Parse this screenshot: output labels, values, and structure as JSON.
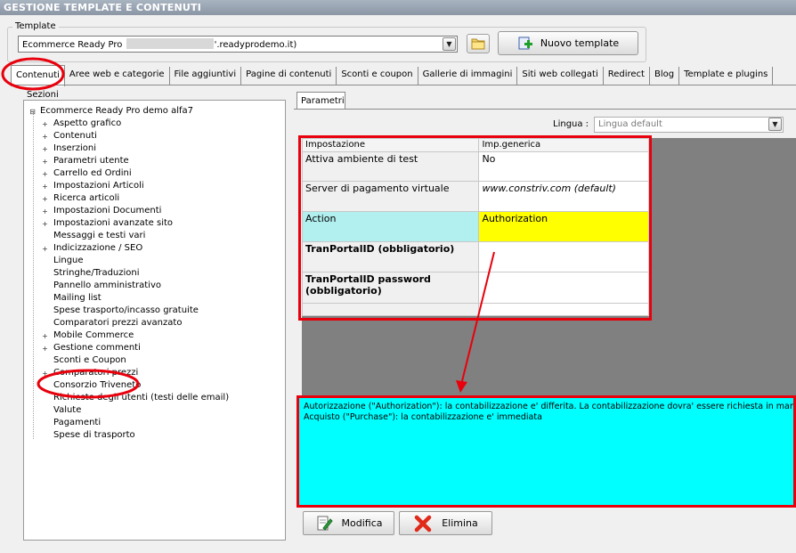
{
  "window": {
    "title": "GESTIONE TEMPLATE E CONTENUTI"
  },
  "template": {
    "group_label": "Template",
    "selected_prefix": "Ecommerce Ready Pro",
    "selected_suffix": "'.readyprodemo.it)",
    "new_button": "Nuovo template"
  },
  "tabs": [
    "Contenuti",
    "Aree web e categorie",
    "File aggiuntivi",
    "Pagine di contenuti",
    "Sconti e coupon",
    "Gallerie di immagini",
    "Siti web collegati",
    "Redirect",
    "Blog",
    "Template e plugins"
  ],
  "sections": {
    "label": "Sezioni",
    "root": "Ecommerce Ready Pro demo alfa7",
    "items": [
      {
        "label": "Aspetto grafico",
        "expandable": true
      },
      {
        "label": "Contenuti",
        "expandable": true
      },
      {
        "label": "Inserzioni",
        "expandable": true
      },
      {
        "label": "Parametri utente",
        "expandable": true
      },
      {
        "label": "Carrello ed Ordini",
        "expandable": true
      },
      {
        "label": "Impostazioni Articoli",
        "expandable": true
      },
      {
        "label": "Ricerca articoli",
        "expandable": true
      },
      {
        "label": "Impostazioni Documenti",
        "expandable": true
      },
      {
        "label": "Impostazioni avanzate sito",
        "expandable": true
      },
      {
        "label": "Messaggi e testi vari",
        "expandable": false
      },
      {
        "label": "Indicizzazione / SEO",
        "expandable": true
      },
      {
        "label": "Lingue",
        "expandable": false
      },
      {
        "label": "Stringhe/Traduzioni",
        "expandable": false
      },
      {
        "label": "Pannello amministrativo",
        "expandable": false
      },
      {
        "label": "Mailing list",
        "expandable": false
      },
      {
        "label": "Spese trasporto/incasso gratuite",
        "expandable": false
      },
      {
        "label": "Comparatori prezzi avanzato",
        "expandable": false
      },
      {
        "label": "Mobile Commerce",
        "expandable": true
      },
      {
        "label": "Gestione commenti",
        "expandable": true
      },
      {
        "label": "Sconti e Coupon",
        "expandable": false
      },
      {
        "label": "Comparatori prezzi",
        "expandable": true
      },
      {
        "label": "Consorzio Triveneto",
        "expandable": false
      },
      {
        "label": "Richieste degli utenti (testi delle email)",
        "expandable": false
      },
      {
        "label": "Valute",
        "expandable": false
      },
      {
        "label": "Pagamenti",
        "expandable": false
      },
      {
        "label": "Spese di trasporto",
        "expandable": false
      }
    ]
  },
  "params": {
    "tab_label": "Parametri",
    "lingua_label": "Lingua :",
    "lingua_value": "Lingua default",
    "col_setting": "Impostazione",
    "col_value": "Imp.generica",
    "rows": [
      {
        "name": "Attiva ambiente di test",
        "value": "No",
        "bold": false,
        "italic": false
      },
      {
        "name": "Server di pagamento virtuale",
        "value": "www.constriv.com (default)",
        "bold": false,
        "italic": true
      },
      {
        "name": "Action",
        "value": "Authorization",
        "bold": false,
        "italic": false,
        "highlight": true
      },
      {
        "name": "TranPortalID (obbligatorio)",
        "value": "",
        "bold": true,
        "italic": false
      },
      {
        "name": "TranPortalID password (obbligatorio)",
        "value": "",
        "bold": true,
        "italic": false
      }
    ],
    "help_line1": "Autorizzazione (\"Authorization\"): la contabilizzazione e' differita. La contabilizzazione dovra' essere richiesta in maniera esplicit",
    "help_line2": "Acquisto (\"Purchase\"): la contabilizzazione e' immediata"
  },
  "actions": {
    "modify": "Modifica",
    "delete": "Elimina"
  },
  "colors": {
    "highlight_red": "#e8000c",
    "action_cell_cyan": "#b2f0f0",
    "action_value_yellow": "#ffff00",
    "help_cyan": "#00ffff",
    "grid_bg_gray": "#808080"
  }
}
